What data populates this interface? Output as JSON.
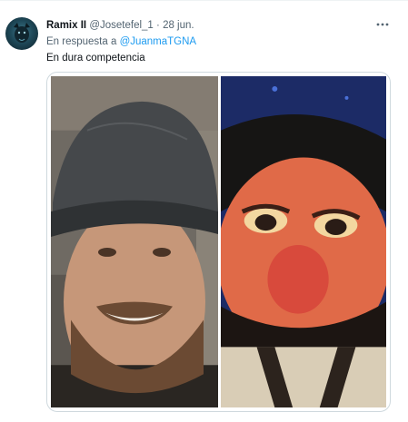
{
  "tweet": {
    "author_name": "Ramix II",
    "author_handle": "@Josetefel_1",
    "separator": "·",
    "date": "28 jun.",
    "reply_prefix": "En respuesta a",
    "reply_mention": "@JuanmaTGNA",
    "text": "En dura competencia"
  },
  "icons": {
    "more": "more-horizontal-icon",
    "avatar": "avatar-image"
  },
  "colors": {
    "name": "#0f1419",
    "secondary": "#536471",
    "mention": "#1d9bf0",
    "border": "#cfd9de"
  }
}
